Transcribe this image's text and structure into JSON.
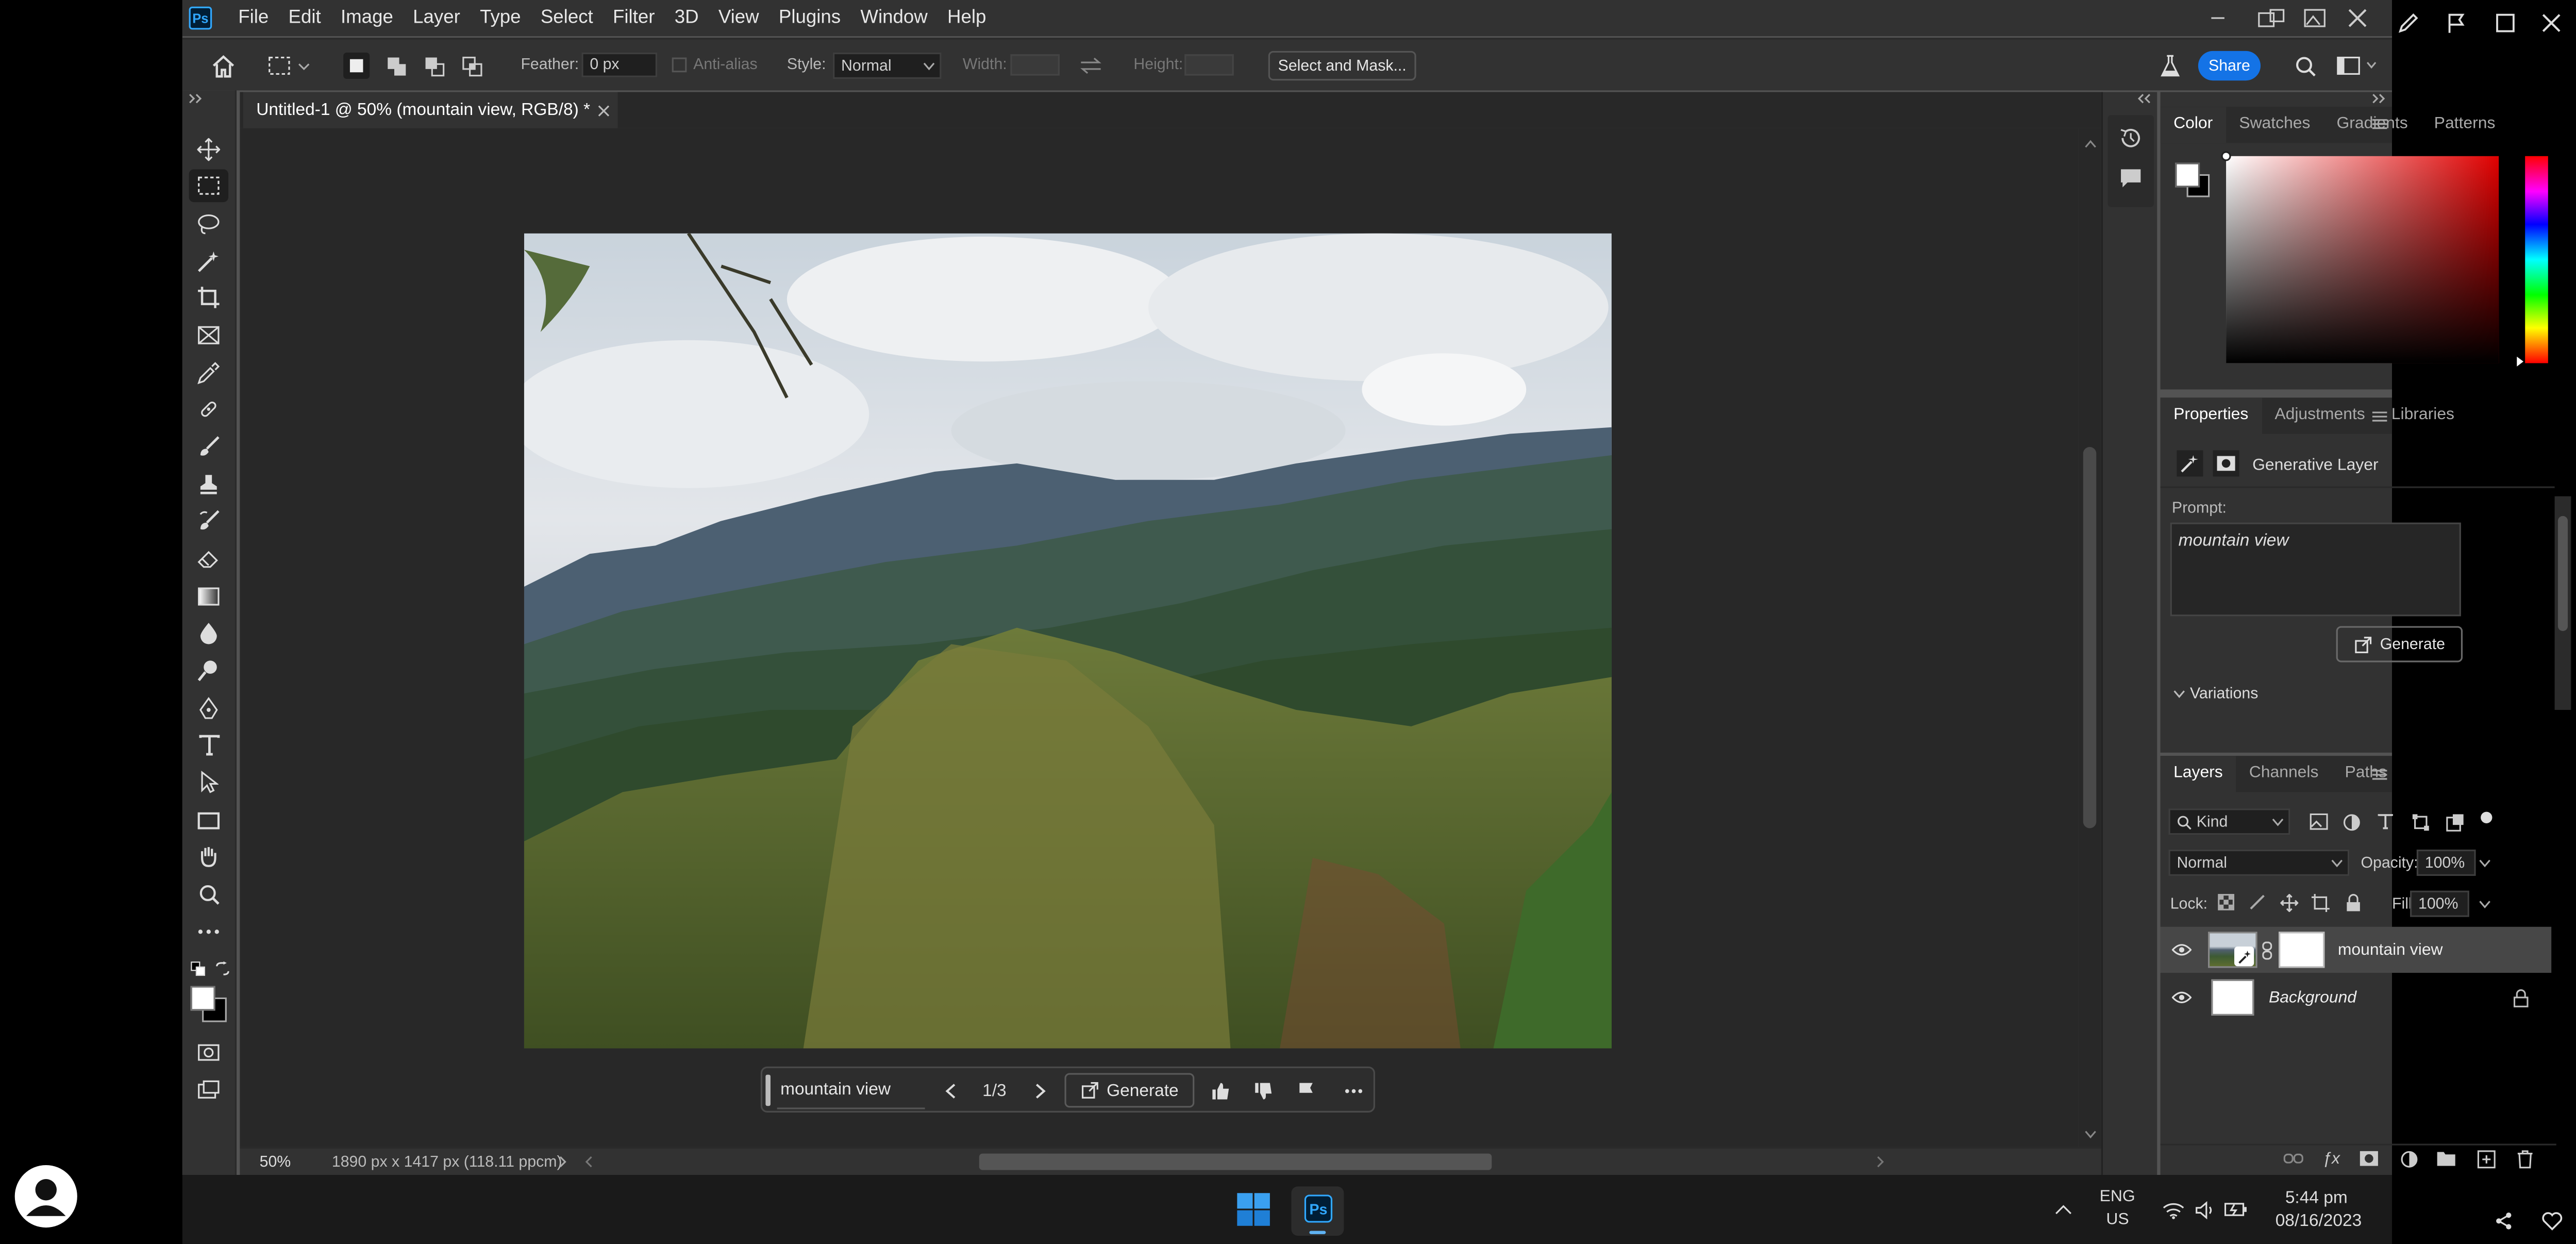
{
  "menu": {
    "ps_badge": "Ps",
    "items": [
      "File",
      "Edit",
      "Image",
      "Layer",
      "Type",
      "Select",
      "Filter",
      "3D",
      "View",
      "Plugins",
      "Window",
      "Help"
    ]
  },
  "options_bar": {
    "feather_label": "Feather:",
    "feather_value": "0 px",
    "antialias_label": "Anti-alias",
    "style_label": "Style:",
    "style_value": "Normal",
    "width_label": "Width:",
    "height_label": "Height:",
    "select_mask_label": "Select and Mask...",
    "share_label": "Share"
  },
  "document": {
    "tab_title": "Untitled-1 @ 50% (mountain view, RGB/8) *",
    "zoom": "50%",
    "dimensions": "1890 px x 1417 px (118.11 ppcm)"
  },
  "gen_bar": {
    "prompt": "mountain view",
    "page": "1/3",
    "generate_label": "Generate"
  },
  "color_panel": {
    "tabs": [
      "Color",
      "Swatches",
      "Gradients",
      "Patterns"
    ],
    "accent": "#e00000"
  },
  "properties_panel": {
    "tabs": [
      "Properties",
      "Adjustments",
      "Libraries"
    ],
    "layer_type": "Generative Layer",
    "prompt_label": "Prompt:",
    "prompt_value": "mountain view",
    "generate_label": "Generate",
    "variations_label": "Variations"
  },
  "layers_panel": {
    "tabs": [
      "Layers",
      "Channels",
      "Paths"
    ],
    "filter_kind": "Kind",
    "blend_mode": "Normal",
    "opacity_label": "Opacity:",
    "opacity_value": "100%",
    "lock_label": "Lock:",
    "fill_label": "Fill:",
    "fill_value": "100%",
    "layers": [
      {
        "name": "mountain view"
      },
      {
        "name": "Background"
      }
    ]
  },
  "taskbar": {
    "ps_label": "Ps",
    "lang_top": "ENG",
    "lang_bottom": "US",
    "time": "5:44 pm",
    "date": "08/16/2023"
  },
  "colors": {
    "share_blue": "#1473e6",
    "app_bg": "#535353",
    "panel_bg": "#323232"
  }
}
